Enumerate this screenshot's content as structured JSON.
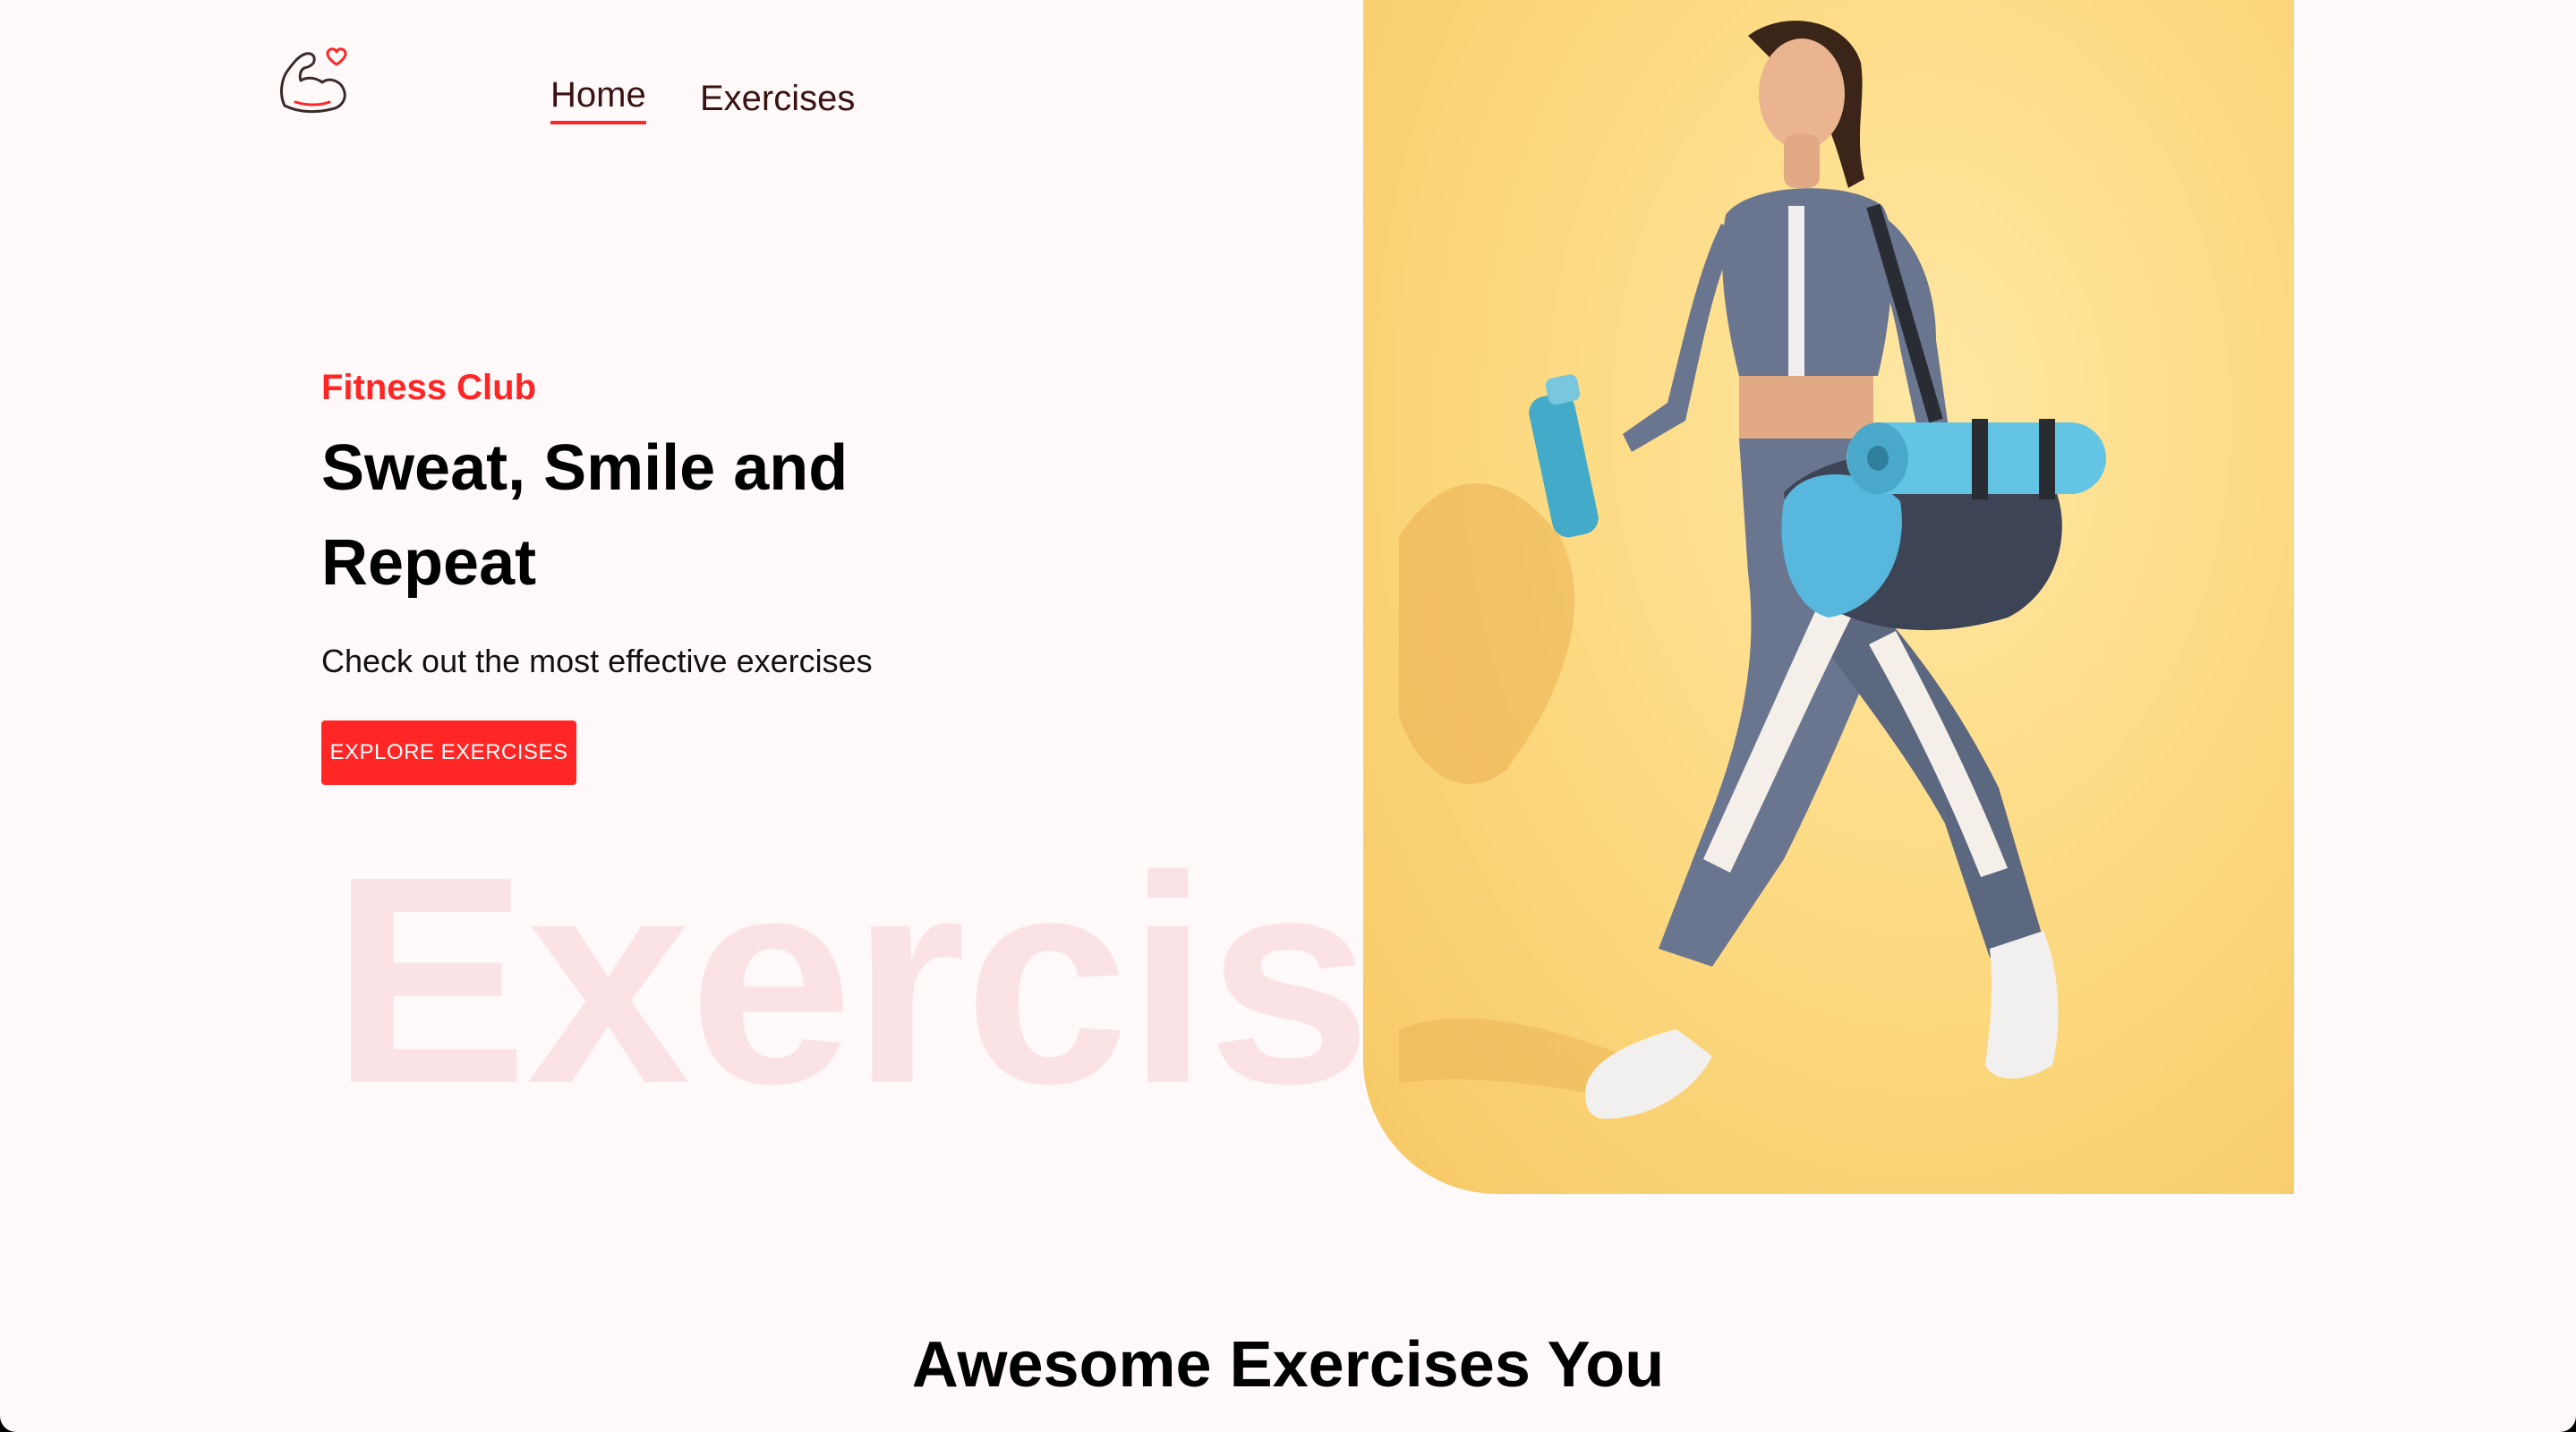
{
  "colors": {
    "accent": "#ff2625",
    "page_background": "#fff9fa",
    "watermark": "#fbe3e5",
    "hero_image_background": "#fddb84"
  },
  "header": {
    "logo_icon": "flexed-arm-heart-icon",
    "nav": [
      {
        "label": "Home",
        "active": true
      },
      {
        "label": "Exercises",
        "active": false
      }
    ]
  },
  "hero": {
    "eyebrow": "Fitness Club",
    "title_line1": "Sweat, Smile and",
    "title_line2": "Repeat",
    "subtitle": "Check out the most effective exercises",
    "button_label": "EXPLORE EXERCISES",
    "watermark_text": "Exercis",
    "image_subject": "woman-walking-with-gym-bag-and-yoga-mat"
  },
  "section": {
    "title": "Awesome Exercises You"
  }
}
